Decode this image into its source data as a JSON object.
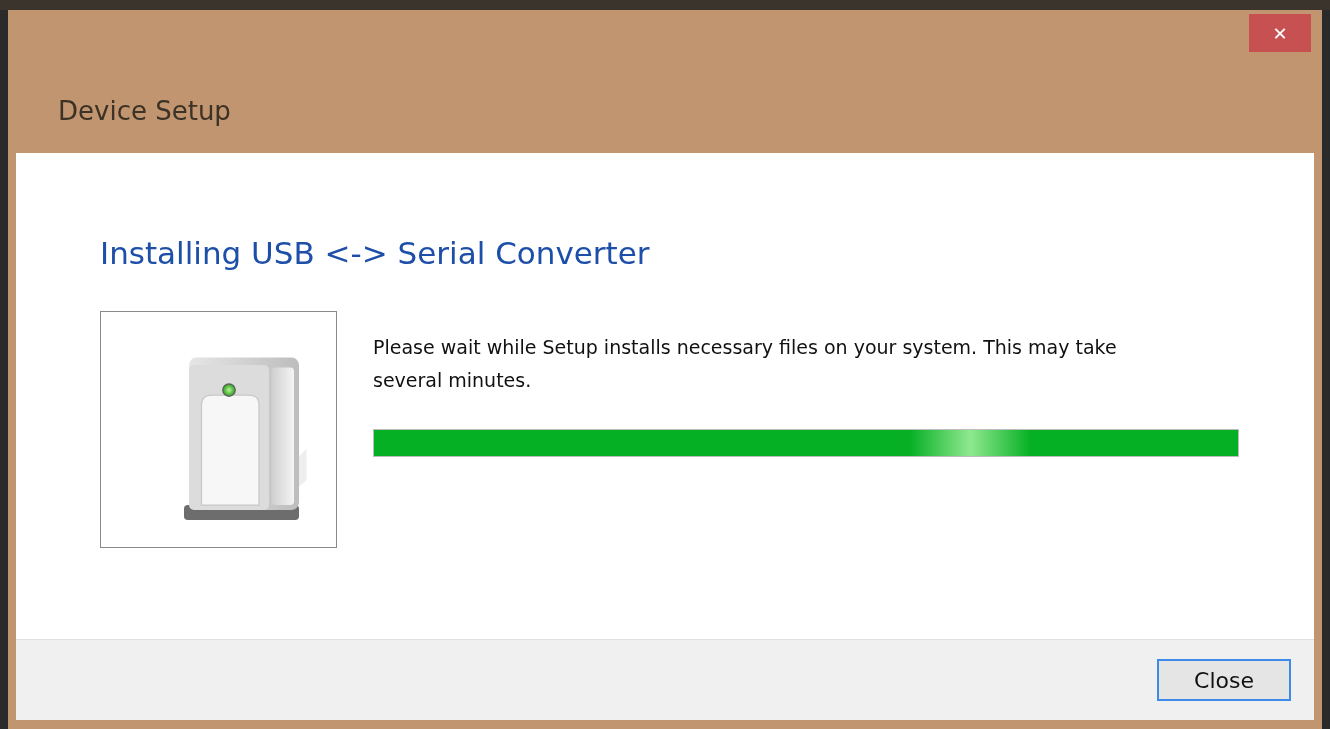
{
  "window": {
    "title": "Device Setup",
    "close_glyph": "✕"
  },
  "heading": "Installing USB <-> Serial Converter",
  "message": "Please wait while Setup installs necessary files on your system. This may take several minutes.",
  "buttons": [
    {
      "label": "Close",
      "focused": true
    }
  ]
}
